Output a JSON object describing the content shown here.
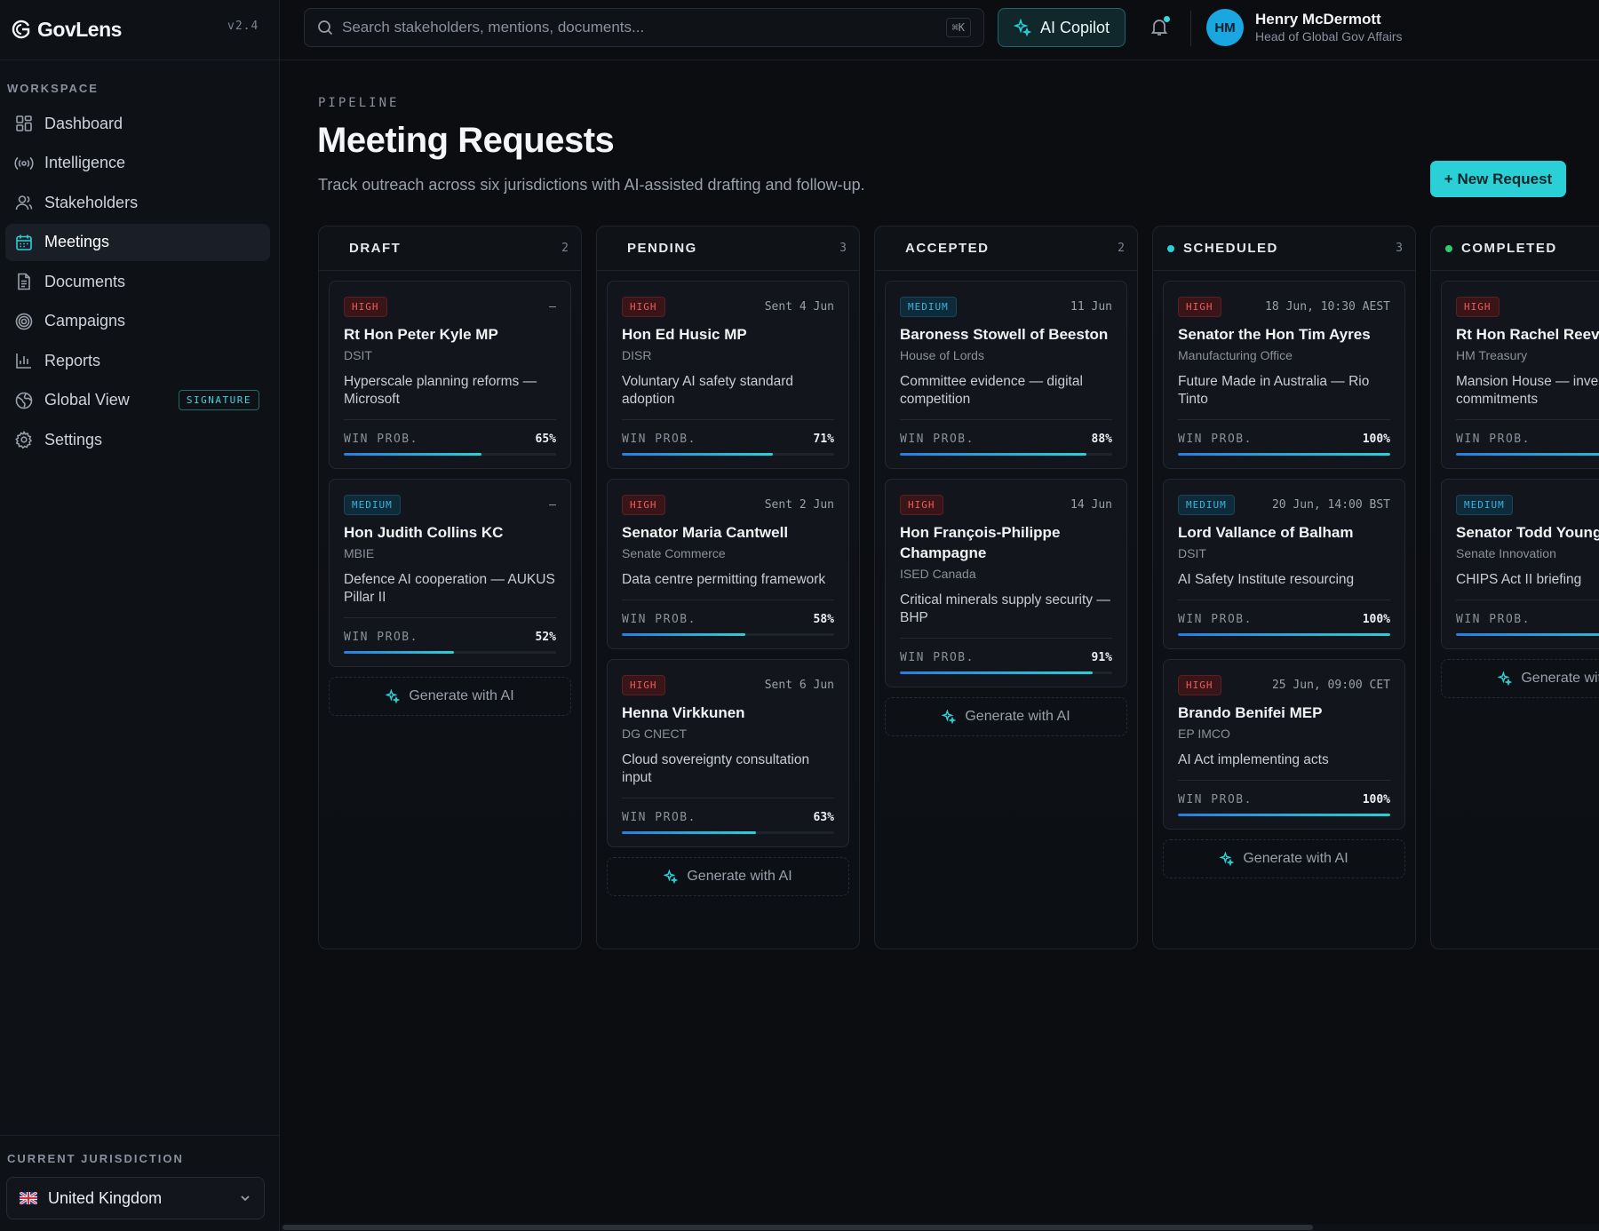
{
  "app": {
    "brand": "GovLens",
    "version": "v2.4"
  },
  "sidebar": {
    "section_label": "WORKSPACE",
    "items": [
      {
        "label": "Dashboard",
        "icon": "grid-icon",
        "active": false
      },
      {
        "label": "Intelligence",
        "icon": "broadcast-icon",
        "active": false
      },
      {
        "label": "Stakeholders",
        "icon": "users-icon",
        "active": false
      },
      {
        "label": "Meetings",
        "icon": "calendar-icon",
        "active": true
      },
      {
        "label": "Documents",
        "icon": "document-icon",
        "active": false
      },
      {
        "label": "Campaigns",
        "icon": "target-icon",
        "active": false
      },
      {
        "label": "Reports",
        "icon": "bar-chart-icon",
        "active": false
      },
      {
        "label": "Global View",
        "icon": "globe-icon",
        "active": false,
        "badge": "SIGNATURE"
      },
      {
        "label": "Settings",
        "icon": "gear-icon",
        "active": false
      }
    ],
    "jurisdiction_label": "CURRENT JURISDICTION",
    "jurisdiction_value": "United Kingdom"
  },
  "topbar": {
    "search_placeholder": "Search stakeholders, mentions, documents...",
    "search_shortcut": "⌘K",
    "copilot_label": "AI Copilot",
    "user": {
      "initials": "HM",
      "name": "Henry McDermott",
      "role": "Head of Global Gov Affairs"
    }
  },
  "page": {
    "eyebrow": "PIPELINE",
    "title": "Meeting Requests",
    "subtitle": "Track outreach across six jurisdictions with AI-assisted drafting and follow-up.",
    "new_button": "+ New Request"
  },
  "labels": {
    "win_prob": "WIN PROB.",
    "generate": "Generate with AI"
  },
  "colors": {
    "accent": "#2ad0d6",
    "high": "#ef5a5a",
    "medium": "#38b3e0",
    "scheduled_dot": "#2ad0d6",
    "completed_dot": "#2ecc71"
  },
  "columns": [
    {
      "title": "DRAFT",
      "count": "2",
      "cards": [
        {
          "priority": "HIGH",
          "date": "–",
          "name": "Rt Hon Peter Kyle MP",
          "org": "DSIT",
          "desc": "Hyperscale planning reforms — Microsoft",
          "prob": "65%"
        },
        {
          "priority": "MEDIUM",
          "date": "–",
          "name": "Hon Judith Collins KC",
          "org": "MBIE",
          "desc": "Defence AI cooperation — AUKUS Pillar II",
          "prob": "52%"
        }
      ]
    },
    {
      "title": "PENDING",
      "count": "3",
      "cards": [
        {
          "priority": "HIGH",
          "date": "Sent 4 Jun",
          "name": "Hon Ed Husic MP",
          "org": "DISR",
          "desc": "Voluntary AI safety standard adoption",
          "prob": "71%"
        },
        {
          "priority": "HIGH",
          "date": "Sent 2 Jun",
          "name": "Senator Maria Cantwell",
          "org": "Senate Commerce",
          "desc": "Data centre permitting framework",
          "prob": "58%"
        },
        {
          "priority": "HIGH",
          "date": "Sent 6 Jun",
          "name": "Henna Virkkunen",
          "org": "DG CNECT",
          "desc": "Cloud sovereignty consultation input",
          "prob": "63%"
        }
      ]
    },
    {
      "title": "ACCEPTED",
      "count": "2",
      "cards": [
        {
          "priority": "MEDIUM",
          "date": "11 Jun",
          "name": "Baroness Stowell of Beeston",
          "org": "House of Lords",
          "desc": "Committee evidence — digital competition",
          "prob": "88%"
        },
        {
          "priority": "HIGH",
          "date": "14 Jun",
          "name": "Hon François-Philippe Champagne",
          "org": "ISED Canada",
          "desc": "Critical minerals supply security — BHP",
          "prob": "91%"
        }
      ]
    },
    {
      "title": "SCHEDULED",
      "count": "3",
      "dot": "scheduled",
      "cards": [
        {
          "priority": "HIGH",
          "date": "18 Jun, 10:30 AEST",
          "name": "Senator the Hon Tim Ayres",
          "org": "Manufacturing Office",
          "desc": "Future Made in Australia — Rio Tinto",
          "prob": "100%"
        },
        {
          "priority": "MEDIUM",
          "date": "20 Jun, 14:00 BST",
          "name": "Lord Vallance of Balham",
          "org": "DSIT",
          "desc": "AI Safety Institute resourcing",
          "prob": "100%"
        },
        {
          "priority": "HIGH",
          "date": "25 Jun, 09:00 CET",
          "name": "Brando Benifei MEP",
          "org": "EP IMCO",
          "desc": "AI Act implementing acts",
          "prob": "100%"
        }
      ]
    },
    {
      "title": "COMPLETED",
      "count": "",
      "dot": "completed",
      "cards": [
        {
          "priority": "HIGH",
          "date": "",
          "name": "Rt Hon Rachel Reeves",
          "org": "HM Treasury",
          "desc": "Mansion House — investment commitments",
          "prob": ""
        },
        {
          "priority": "MEDIUM",
          "date": "",
          "name": "Senator Todd Young",
          "org": "Senate Innovation",
          "desc": "CHIPS Act II briefing",
          "prob": ""
        }
      ]
    }
  ],
  "prob_values": [
    [
      0.65,
      0.52
    ],
    [
      0.71,
      0.58,
      0.63
    ],
    [
      0.88,
      0.91
    ],
    [
      1.0,
      1.0,
      1.0
    ],
    [
      1.0,
      1.0
    ]
  ]
}
